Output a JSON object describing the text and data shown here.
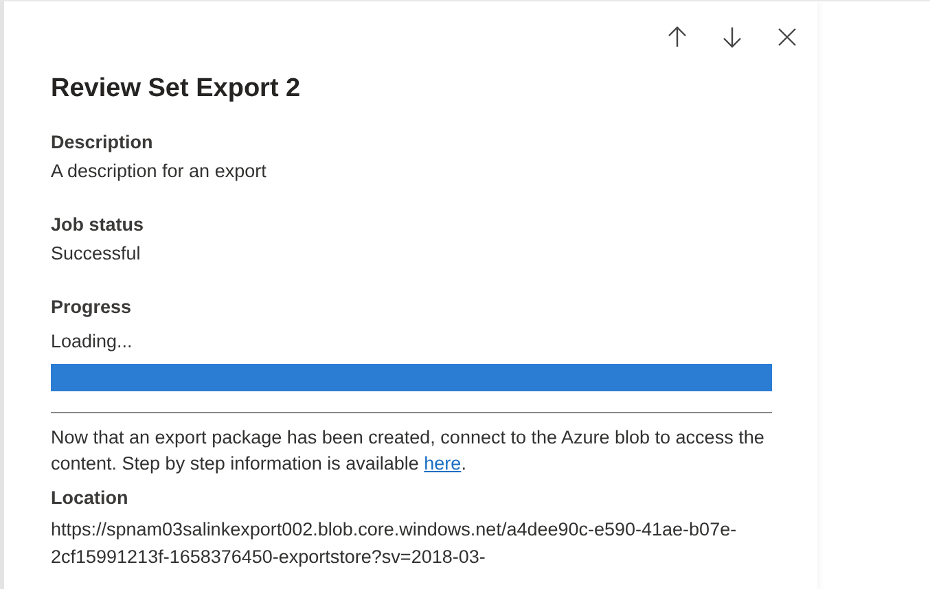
{
  "panel": {
    "title": "Review Set Export 2"
  },
  "sections": [
    {
      "label": "Description",
      "value": "A description for an export"
    },
    {
      "label": "Job status",
      "value": "Successful"
    }
  ],
  "progress": {
    "label": "Progress",
    "status": "Loading...",
    "level": 1
  },
  "note": {
    "text": "Now that an export package has been created, connect to the Azure blob to access the content. Step by step information is available ",
    "link": "here",
    "after": "."
  },
  "location": {
    "label": "Location",
    "value": "https://spnam03salinkexport002.blob.core.windows.net/a4dee90c-e590-41ae-b07e-2cf15991213f-1658376450-exportstore?sv=2018-03-"
  }
}
